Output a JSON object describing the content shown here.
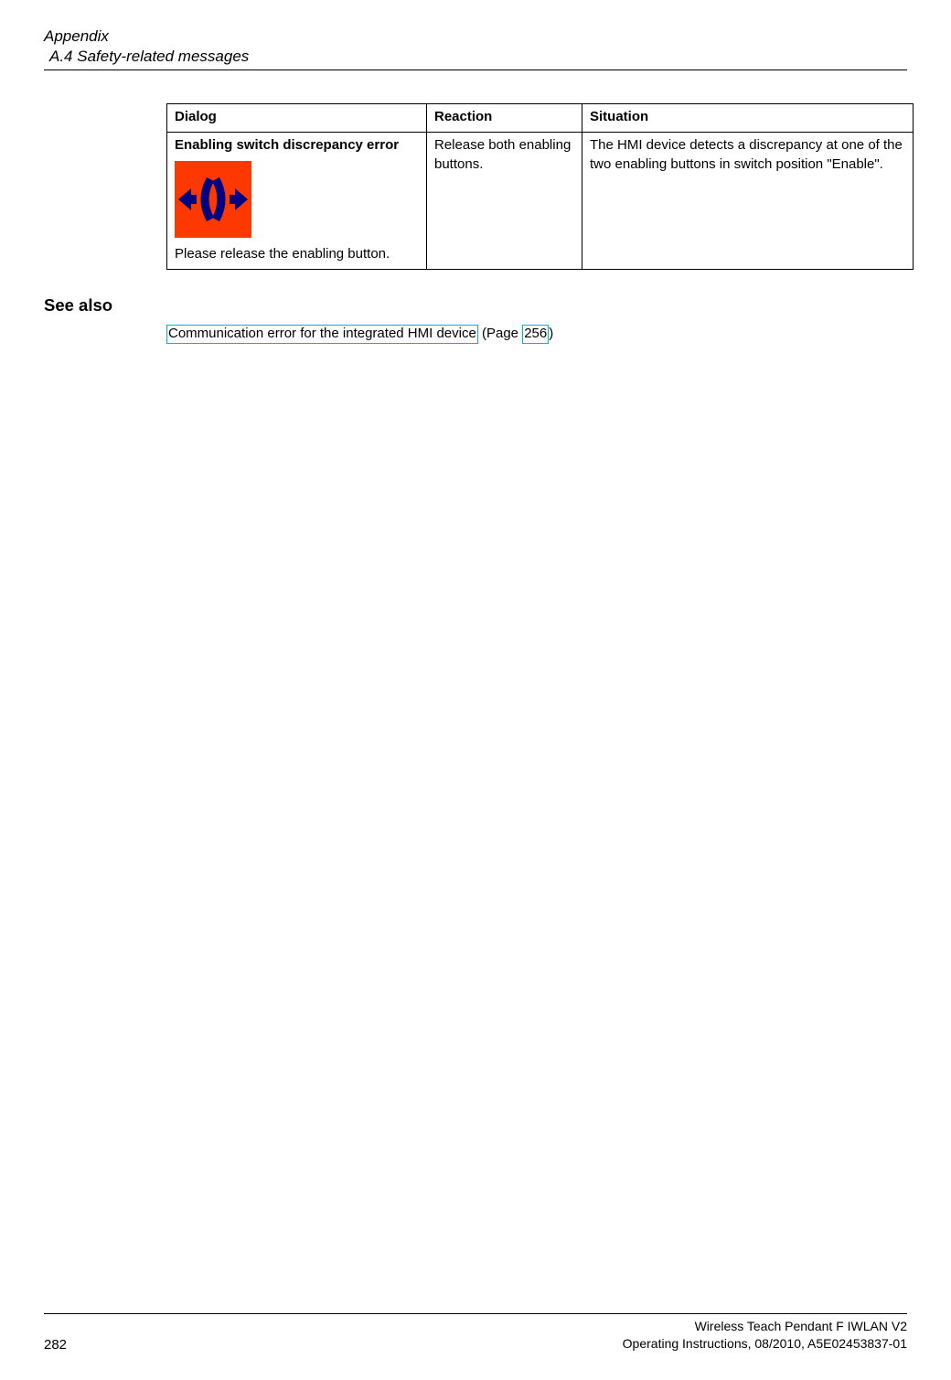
{
  "header": {
    "appendix": "Appendix",
    "section": "A.4 Safety-related messages"
  },
  "table": {
    "columns": {
      "dialog": "Dialog",
      "reaction": "Reaction",
      "situation": "Situation"
    },
    "row": {
      "dialog_title": "Enabling switch discrepancy error",
      "dialog_instruction": "Please release the enabling button.",
      "reaction": "Release both enabling buttons.",
      "situation": "The HMI device detects a discrepancy at one of the two enabling buttons in switch position \"Enable\"."
    }
  },
  "see_also": {
    "heading": "See also",
    "link_text": "Communication error for the integrated HMI device",
    "open_paren": " (Page ",
    "page_link": "256",
    "close_paren": ")"
  },
  "footer": {
    "page_number": "282",
    "doc_title": "Wireless Teach Pendant F IWLAN V2",
    "doc_info": "Operating Instructions, 08/2010, A5E02453837-01"
  }
}
